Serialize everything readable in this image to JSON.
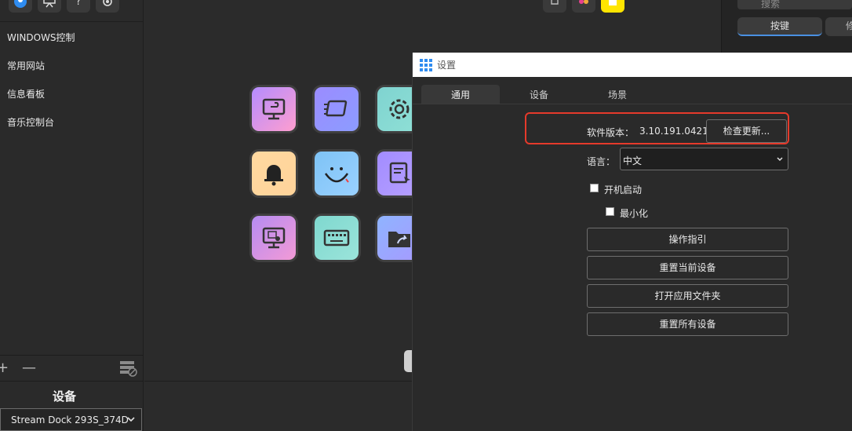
{
  "left_panel": {
    "nav_items": [
      {
        "label": "WINDOWS控制"
      },
      {
        "label": "常用网站"
      },
      {
        "label": "信息看板"
      },
      {
        "label": "音乐控制台"
      }
    ],
    "add_symbol": "+",
    "remove_symbol": "—",
    "device_title": "设备",
    "device_select_value": "Stream Dock 293S_374D"
  },
  "keys": [
    {
      "icon": "monitor-back-icon",
      "gradient": [
        "#b48cff",
        "#ff9ecf"
      ]
    },
    {
      "icon": "window-speed-icon",
      "gradient": [
        "#9b8cff",
        "#8c9cff"
      ]
    },
    {
      "icon": "gear-icon",
      "gradient": [
        "#7fd3d0",
        "#8fe0d6"
      ]
    },
    {
      "icon": "bell-icon",
      "gradient": [
        "#ffd9a0",
        "#ffd39a"
      ]
    },
    {
      "icon": "smiley-icon",
      "gradient": [
        "#7ec3f5",
        "#9ad1ff"
      ]
    },
    {
      "icon": "document-pointer-icon",
      "gradient": [
        "#a28cff",
        "#b6a0ff"
      ]
    },
    {
      "icon": "monitor-settings-icon",
      "gradient": [
        "#b58cf2",
        "#f39ad6"
      ]
    },
    {
      "icon": "keyboard-icon",
      "gradient": [
        "#7fd8cf",
        "#9be4da"
      ]
    },
    {
      "icon": "folder-share-icon",
      "gradient": [
        "#8fb4ff",
        "#a69aff"
      ]
    }
  ],
  "right_panel": {
    "search_placeholder": "搜索",
    "tab_keys": "按键",
    "tab_other": "修"
  },
  "dialog": {
    "title": "设置",
    "tabs": [
      {
        "label": "通用"
      },
      {
        "label": "设备"
      },
      {
        "label": "场景"
      }
    ],
    "version_label": "软件版本：",
    "version_value": "3.10.191.0421",
    "check_update_label": "检查更新...",
    "language_label": "语言：",
    "language_value": "中文",
    "checkbox_startup": "开机启动",
    "checkbox_minimize": "最小化",
    "buttons": [
      {
        "label": "操作指引"
      },
      {
        "label": "重置当前设备"
      },
      {
        "label": "打开应用文件夹"
      },
      {
        "label": "重置所有设备"
      }
    ]
  },
  "colors": {
    "accent_blue": "#4a90e2",
    "highlight_red": "#e53a2b"
  }
}
